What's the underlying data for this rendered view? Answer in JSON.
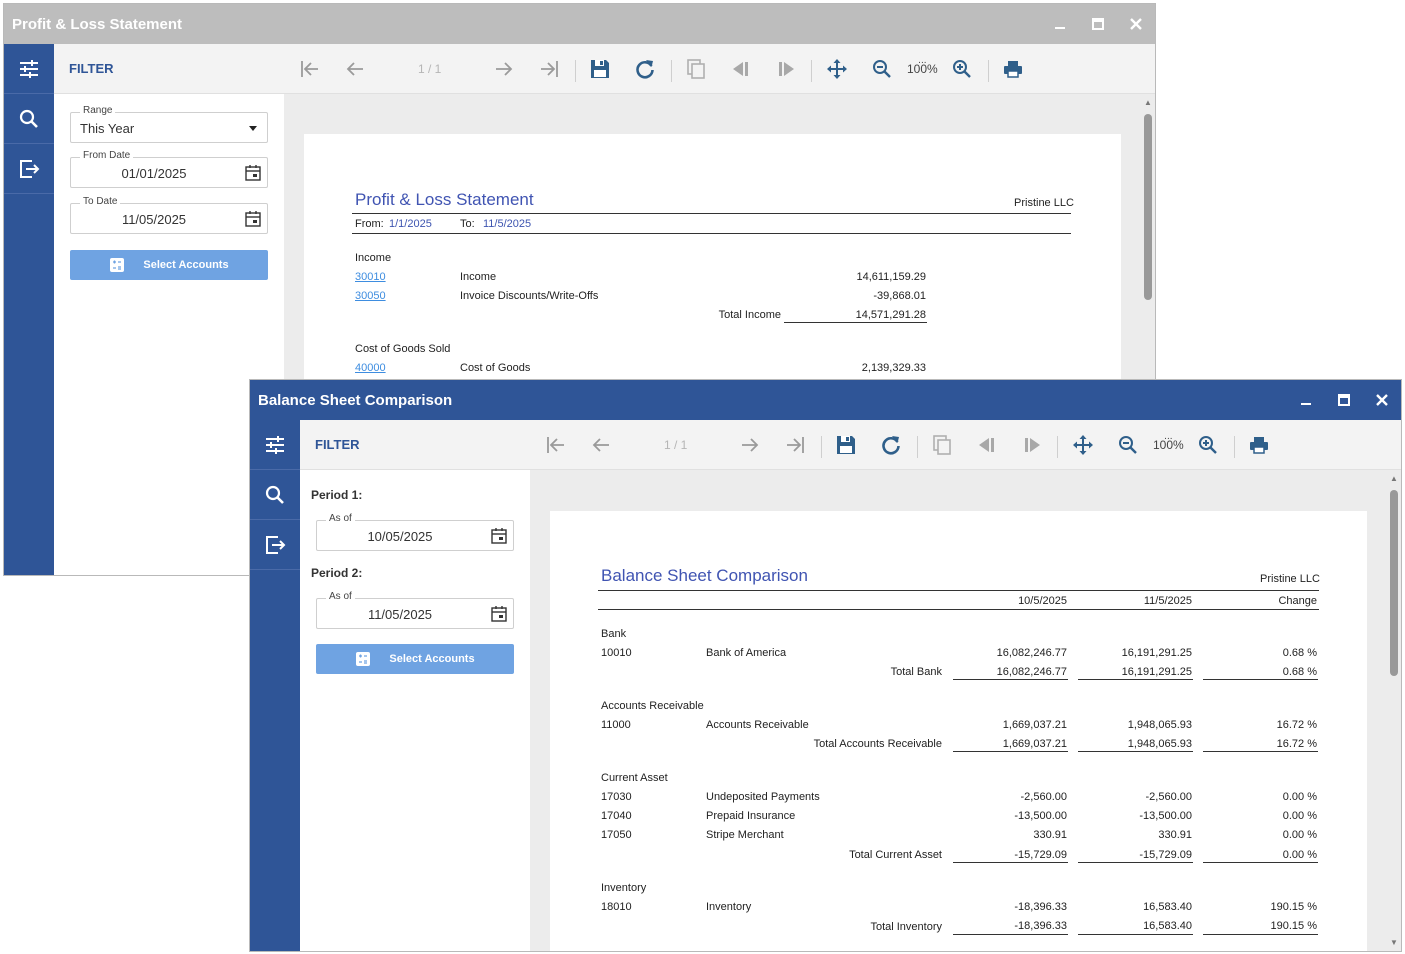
{
  "pl_window": {
    "title": "Profit & Loss Statement",
    "controls": {
      "minimize": "—",
      "maximize": "□",
      "close": "✕"
    },
    "filter_label": "FILTER",
    "page_indicator": "1 / 1",
    "zoom": "100%",
    "zoom_more": "...",
    "filters": {
      "range": {
        "label": "Range",
        "value": "This Year"
      },
      "from_date": {
        "label": "From Date",
        "value": "01/01/2025"
      },
      "to_date": {
        "label": "To Date",
        "value": "11/05/2025"
      },
      "select_accounts": "Select Accounts"
    },
    "report": {
      "title": "Profit & Loss Statement",
      "company": "Pristine LLC",
      "from_label": "From:",
      "from_value": "1/1/2025",
      "to_label": "To:",
      "to_value": "11/5/2025",
      "income_heading": "Income",
      "income_rows": [
        {
          "account": "30010",
          "name": "Income",
          "amount": "14,611,159.29"
        },
        {
          "account": "30050",
          "name": "Invoice Discounts/Write-Offs",
          "amount": "-39,868.01"
        }
      ],
      "total_income_label": "Total Income",
      "total_income_value": "14,571,291.28",
      "cogs_heading": "Cost of Goods Sold",
      "cogs_rows": [
        {
          "account": "40000",
          "name": "Cost of Goods",
          "amount": "2,139,329.33"
        }
      ]
    }
  },
  "bs_window": {
    "title": "Balance Sheet Comparison",
    "controls": {
      "minimize": "—",
      "maximize": "□",
      "close": "✕"
    },
    "filter_label": "FILTER",
    "page_indicator": "1 / 1",
    "zoom": "100%",
    "zoom_more": "...",
    "filters": {
      "period1_label": "Period 1:",
      "period1": {
        "label": "As of",
        "value": "10/05/2025"
      },
      "period2_label": "Period 2:",
      "period2": {
        "label": "As of",
        "value": "11/05/2025"
      },
      "select_accounts": "Select Accounts"
    },
    "report": {
      "title": "Balance Sheet Comparison",
      "company": "Pristine LLC",
      "col1": "10/5/2025",
      "col2": "11/5/2025",
      "col3": "Change",
      "sections": [
        {
          "heading": "Bank",
          "rows": [
            {
              "account": "10010",
              "name": "Bank of America",
              "v1": "16,082,246.77",
              "v2": "16,191,291.25",
              "chg": "0.68 %"
            }
          ],
          "total_label": "Total Bank",
          "total": {
            "v1": "16,082,246.77",
            "v2": "16,191,291.25",
            "chg": "0.68 %"
          }
        },
        {
          "heading": "Accounts Receivable",
          "rows": [
            {
              "account": "11000",
              "name": "Accounts Receivable",
              "v1": "1,669,037.21",
              "v2": "1,948,065.93",
              "chg": "16.72 %"
            }
          ],
          "total_label": "Total Accounts Receivable",
          "total": {
            "v1": "1,669,037.21",
            "v2": "1,948,065.93",
            "chg": "16.72 %"
          }
        },
        {
          "heading": "Current Asset",
          "rows": [
            {
              "account": "17030",
              "name": "Undeposited Payments",
              "v1": "-2,560.00",
              "v2": "-2,560.00",
              "chg": "0.00 %"
            },
            {
              "account": "17040",
              "name": "Prepaid Insurance",
              "v1": "-13,500.00",
              "v2": "-13,500.00",
              "chg": "0.00 %"
            },
            {
              "account": "17050",
              "name": "Stripe Merchant",
              "v1": "330.91",
              "v2": "330.91",
              "chg": "0.00 %"
            }
          ],
          "total_label": "Total Current Asset",
          "total": {
            "v1": "-15,729.09",
            "v2": "-15,729.09",
            "chg": "0.00 %"
          }
        },
        {
          "heading": "Inventory",
          "rows": [
            {
              "account": "18010",
              "name": "Inventory",
              "v1": "-18,396.33",
              "v2": "16,583.40",
              "chg": "190.15 %"
            }
          ],
          "total_label": "Total Inventory",
          "total": {
            "v1": "-18,396.33",
            "v2": "16,583.40",
            "chg": "190.15 %"
          }
        }
      ]
    }
  },
  "colors": {
    "inactive_titlebar": "#bdbdbd",
    "active_titlebar": "#2f5597",
    "rail": "#2f5597",
    "accent_button": "#6fa3e2",
    "report_title": "#4054b2",
    "link": "#3e8de0"
  }
}
